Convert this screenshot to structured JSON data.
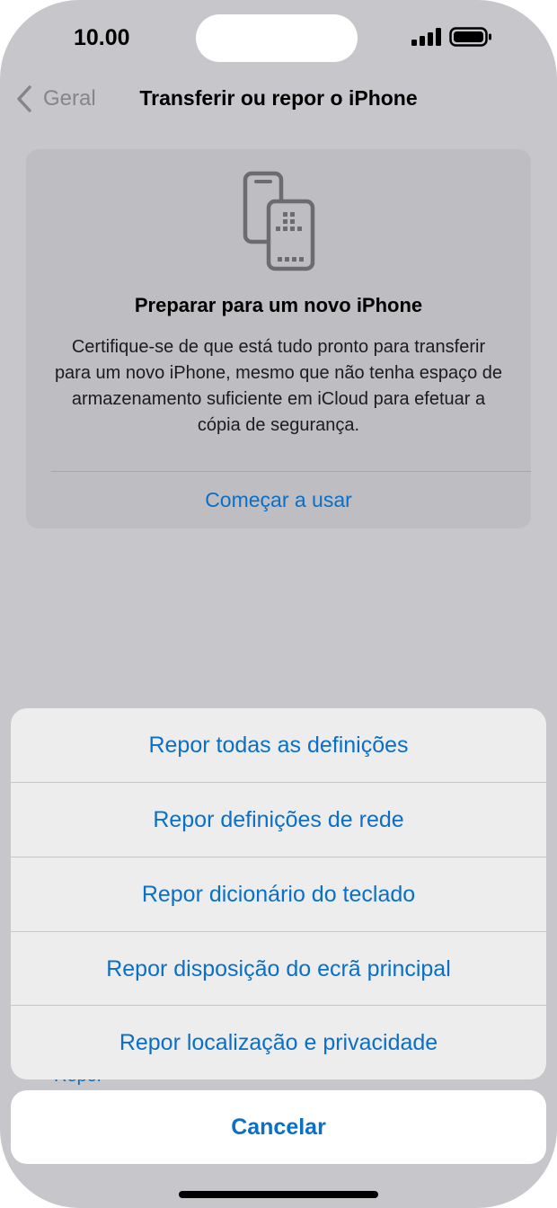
{
  "status_bar": {
    "time": "10.00"
  },
  "nav": {
    "back_label": "Geral",
    "title": "Transferir ou repor o iPhone"
  },
  "prepare_card": {
    "icon": "two-iphones-icon",
    "title": "Preparar para um novo iPhone",
    "body": "Certifique-se de que está tudo pronto para transferir para um novo iPhone, mesmo que não tenha espaço de armazenamento suficiente em iCloud para efetuar a cópia de segurança.",
    "action_label": "Começar a usar"
  },
  "background_peek": {
    "label": "Repor"
  },
  "action_sheet": {
    "items": [
      {
        "label": "Repor todas as definições"
      },
      {
        "label": "Repor definições de rede"
      },
      {
        "label": "Repor dicionário do teclado"
      },
      {
        "label": "Repor disposição do ecrã principal"
      },
      {
        "label": "Repor localização e privacidade"
      }
    ],
    "cancel_label": "Cancelar"
  },
  "colors": {
    "accent": "#0a6fc7",
    "dimmed_background": "#c6c6cb",
    "sheet": "#ededed"
  }
}
